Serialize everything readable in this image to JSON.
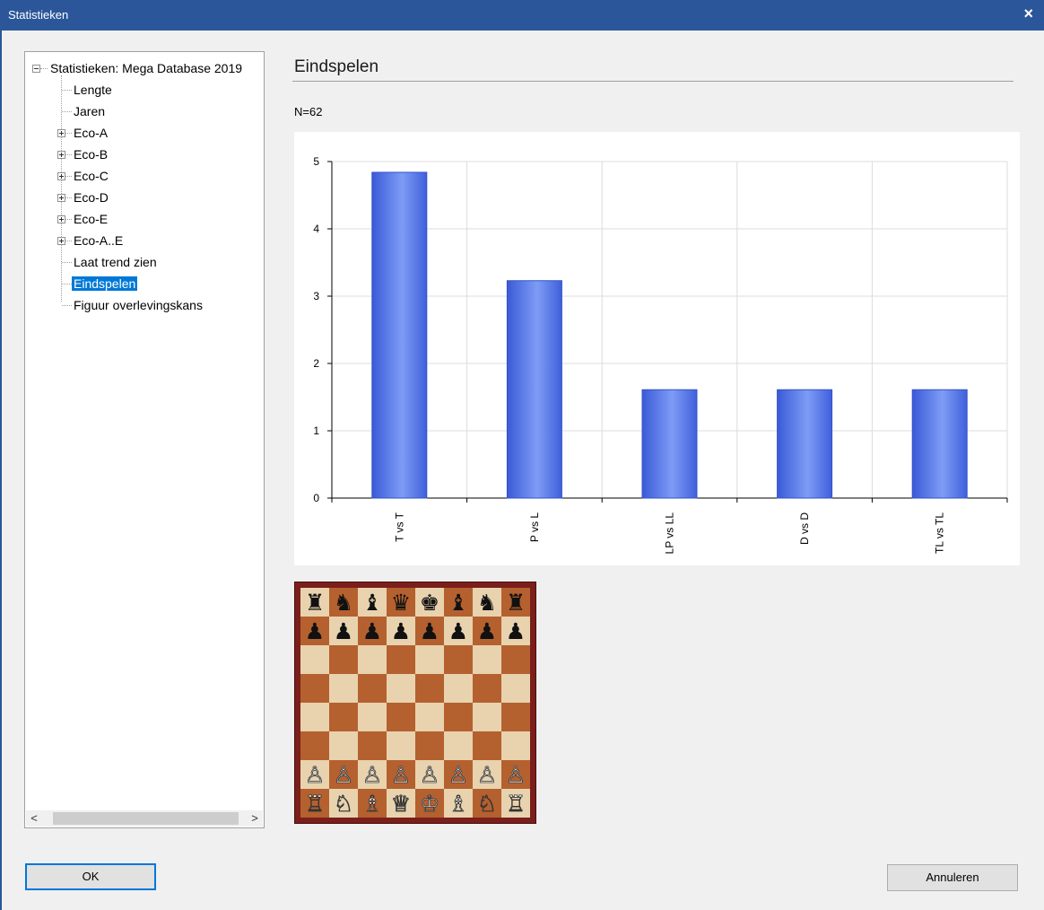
{
  "window": {
    "title": "Statistieken",
    "close_glyph": "×"
  },
  "tree": {
    "root": "Statistieken: Mega Database 2019",
    "items": [
      {
        "label": "Lengte",
        "expandable": false
      },
      {
        "label": "Jaren",
        "expandable": false
      },
      {
        "label": "Eco-A",
        "expandable": true
      },
      {
        "label": "Eco-B",
        "expandable": true
      },
      {
        "label": "Eco-C",
        "expandable": true
      },
      {
        "label": "Eco-D",
        "expandable": true
      },
      {
        "label": "Eco-E",
        "expandable": true
      },
      {
        "label": "Eco-A..E",
        "expandable": true
      },
      {
        "label": "Laat trend zien",
        "expandable": false
      },
      {
        "label": "Eindspelen",
        "expandable": false,
        "selected": true
      },
      {
        "label": "Figuur overlevingskans",
        "expandable": false
      }
    ],
    "scroll_left": "<",
    "scroll_right": ">"
  },
  "main": {
    "heading": "Eindspelen",
    "n_label": "N=62"
  },
  "chart_data": {
    "type": "bar",
    "title": "",
    "xlabel": "",
    "ylabel": "",
    "categories": [
      "T vs T",
      "P vs L",
      "LP vs LL",
      "D vs D",
      "TL vs TL"
    ],
    "values": [
      4.84,
      3.23,
      1.61,
      1.61,
      1.61
    ],
    "ylim": [
      0,
      5
    ],
    "yticks": [
      0,
      1,
      2,
      3,
      4,
      5
    ],
    "grid": true,
    "bar_color": "#5578e8"
  },
  "board": {
    "rows": [
      [
        "♜",
        "♞",
        "♝",
        "♛",
        "♚",
        "♝",
        "♞",
        "♜"
      ],
      [
        "♟",
        "♟",
        "♟",
        "♟",
        "♟",
        "♟",
        "♟",
        "♟"
      ],
      [
        "",
        "",
        "",
        "",
        "",
        "",
        "",
        ""
      ],
      [
        "",
        "",
        "",
        "",
        "",
        "",
        "",
        ""
      ],
      [
        "",
        "",
        "",
        "",
        "",
        "",
        "",
        ""
      ],
      [
        "",
        "",
        "",
        "",
        "",
        "",
        "",
        ""
      ],
      [
        "♙",
        "♙",
        "♙",
        "♙",
        "♙",
        "♙",
        "♙",
        "♙"
      ],
      [
        "♖",
        "♘",
        "♗",
        "♕",
        "♔",
        "♗",
        "♘",
        "♖"
      ]
    ]
  },
  "buttons": {
    "ok": "OK",
    "cancel": "Annuleren"
  }
}
